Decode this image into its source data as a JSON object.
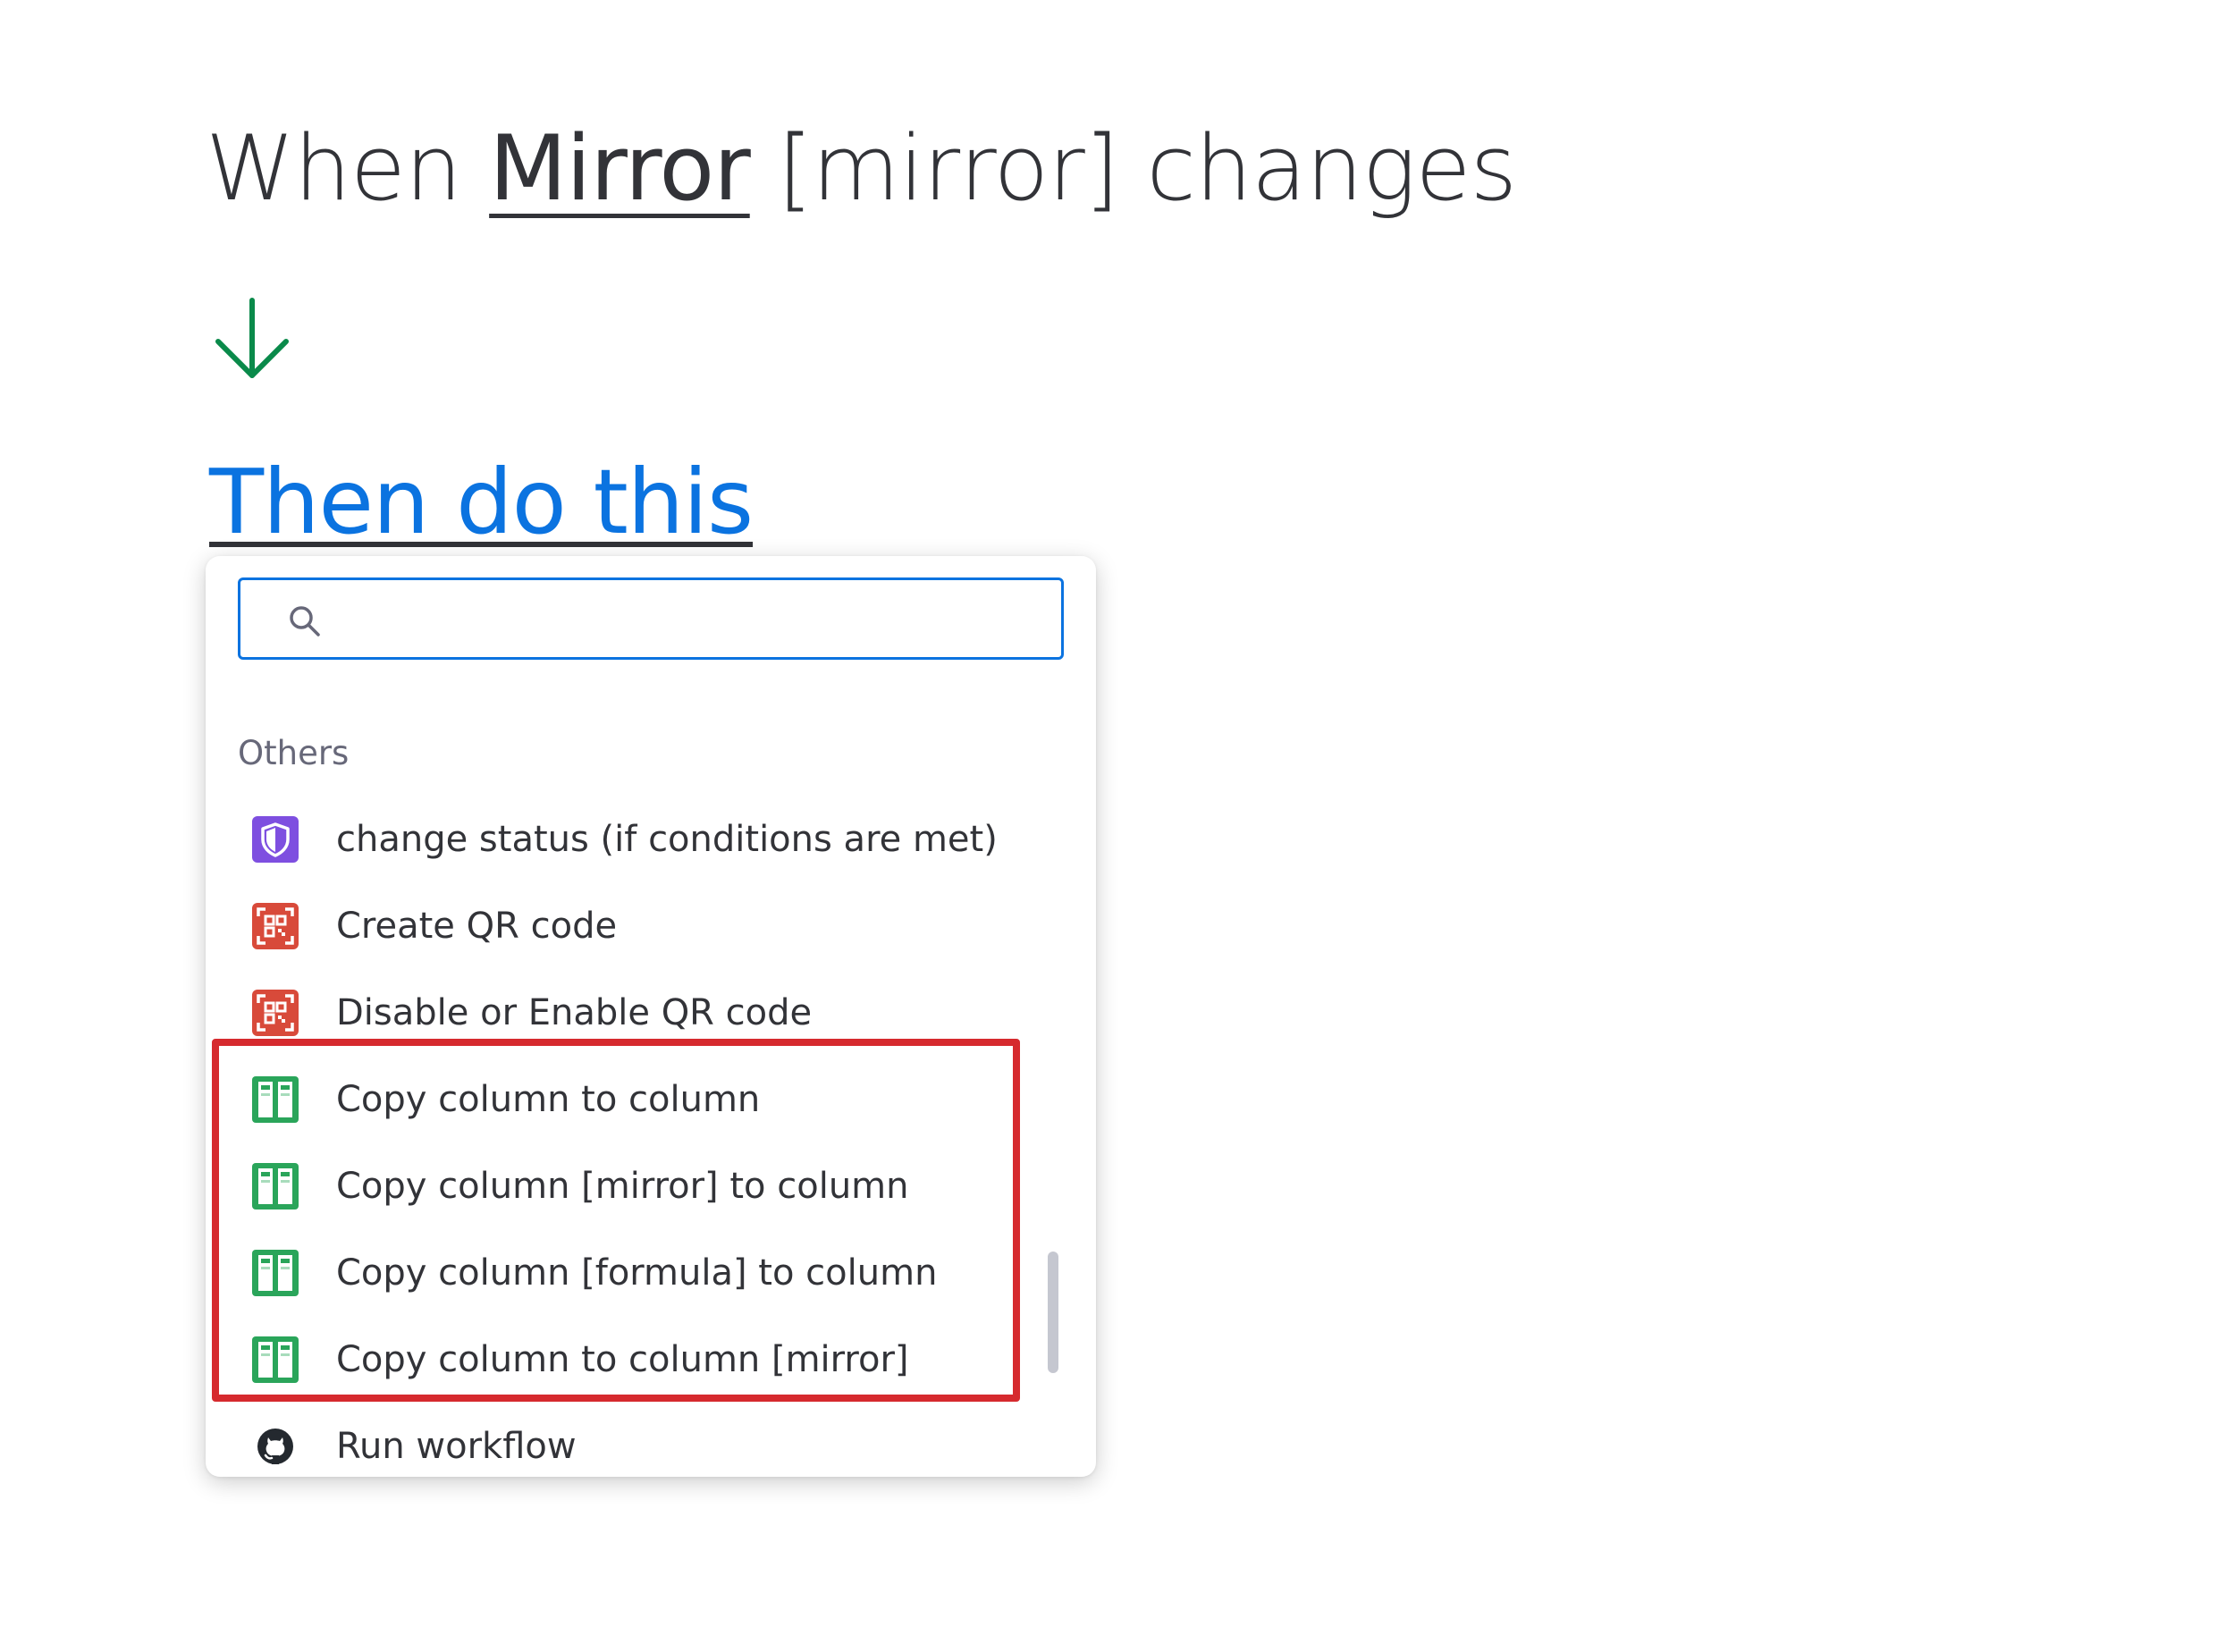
{
  "trigger": {
    "prefix": "When",
    "column_link": "Mirror",
    "suffix": "[mirror] changes"
  },
  "action_heading": "Then do this",
  "dropdown": {
    "search": {
      "value": "",
      "placeholder": ""
    },
    "section_title": "Others",
    "items": [
      {
        "label": "change status (if conditions are met)",
        "icon": "shield-icon"
      },
      {
        "label": "Create QR code",
        "icon": "qr-code-icon"
      },
      {
        "label": "Disable or Enable QR code",
        "icon": "qr-code-icon"
      },
      {
        "label": "Copy column to column",
        "icon": "columns-icon"
      },
      {
        "label": "Copy column [mirror] to column",
        "icon": "columns-icon"
      },
      {
        "label": "Copy column [formula] to column",
        "icon": "columns-icon"
      },
      {
        "label": "Copy column to column [mirror]",
        "icon": "columns-icon"
      },
      {
        "label": "Run workflow",
        "icon": "github-icon"
      }
    ]
  },
  "colors": {
    "accent_blue": "#0b73e0",
    "arrow_green": "#0a8a4a",
    "highlight_red": "#d62a2e",
    "shield_purple": "#7e4fe0",
    "qr_red": "#d84a3a",
    "columns_green": "#2aa55a"
  }
}
